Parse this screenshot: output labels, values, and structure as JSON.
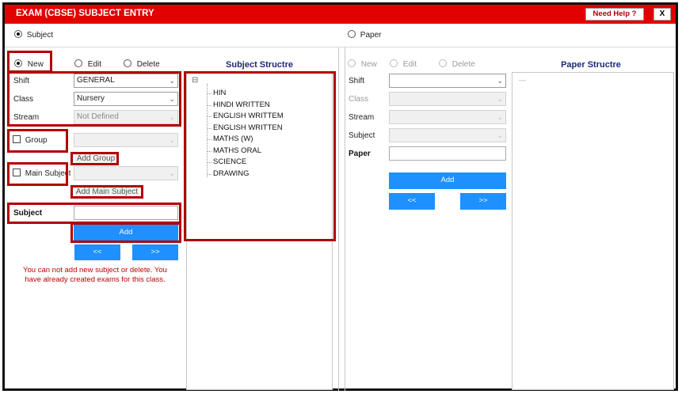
{
  "window": {
    "title": "EXAM (CBSE) SUBJECT ENTRY",
    "help_label": "Need Help ?",
    "close_label": "X"
  },
  "mode": {
    "subject_label": "Subject",
    "paper_label": "Paper",
    "selected": "Subject"
  },
  "left": {
    "actions": {
      "new_label": "New",
      "edit_label": "Edit",
      "delete_label": "Delete",
      "selected": "New"
    },
    "shift": {
      "label": "Shift",
      "value": "GENERAL"
    },
    "class": {
      "label": "Class",
      "value": "Nursery"
    },
    "stream": {
      "label": "Stream",
      "value": "Not Defined"
    },
    "group": {
      "label": "Group",
      "value": "",
      "add_label": "Add Group"
    },
    "main_subject": {
      "label": "Main Subject",
      "value": "",
      "add_label": "Add Main Subject"
    },
    "subject": {
      "label": "Subject",
      "value": ""
    },
    "add_label": "Add",
    "prev_label": "<<",
    "next_label": ">>",
    "error": "You can not add new subject or delete. You have already created exams for this class."
  },
  "subject_structure": {
    "heading": "Subject Structre",
    "root_toggle": "⊟",
    "items": [
      "HIN",
      "HINDI WRITTEN",
      "ENGLISH WRITTEM",
      "ENGLISH WRITTEN",
      "MATHS (W)",
      "MATHS ORAL",
      "SCIENCE",
      "DRAWING"
    ]
  },
  "paper": {
    "actions": {
      "new_label": "New",
      "edit_label": "Edit",
      "delete_label": "Delete"
    },
    "shift": {
      "label": "Shift",
      "value": ""
    },
    "class": {
      "label": "Class",
      "value": ""
    },
    "stream": {
      "label": "Stream",
      "value": ""
    },
    "subject": {
      "label": "Subject",
      "value": ""
    },
    "paper": {
      "label": "Paper",
      "value": ""
    },
    "add_label": "Add",
    "prev_label": "<<",
    "next_label": ">>"
  },
  "paper_structure": {
    "heading": "Paper Structre",
    "root_marker": "—"
  },
  "colors": {
    "title_bar": "#e30000",
    "highlight_box": "#b00000",
    "button_blue": "#1e90ff",
    "heading_navy": "#1a2a7a",
    "error_red": "#c00000"
  }
}
